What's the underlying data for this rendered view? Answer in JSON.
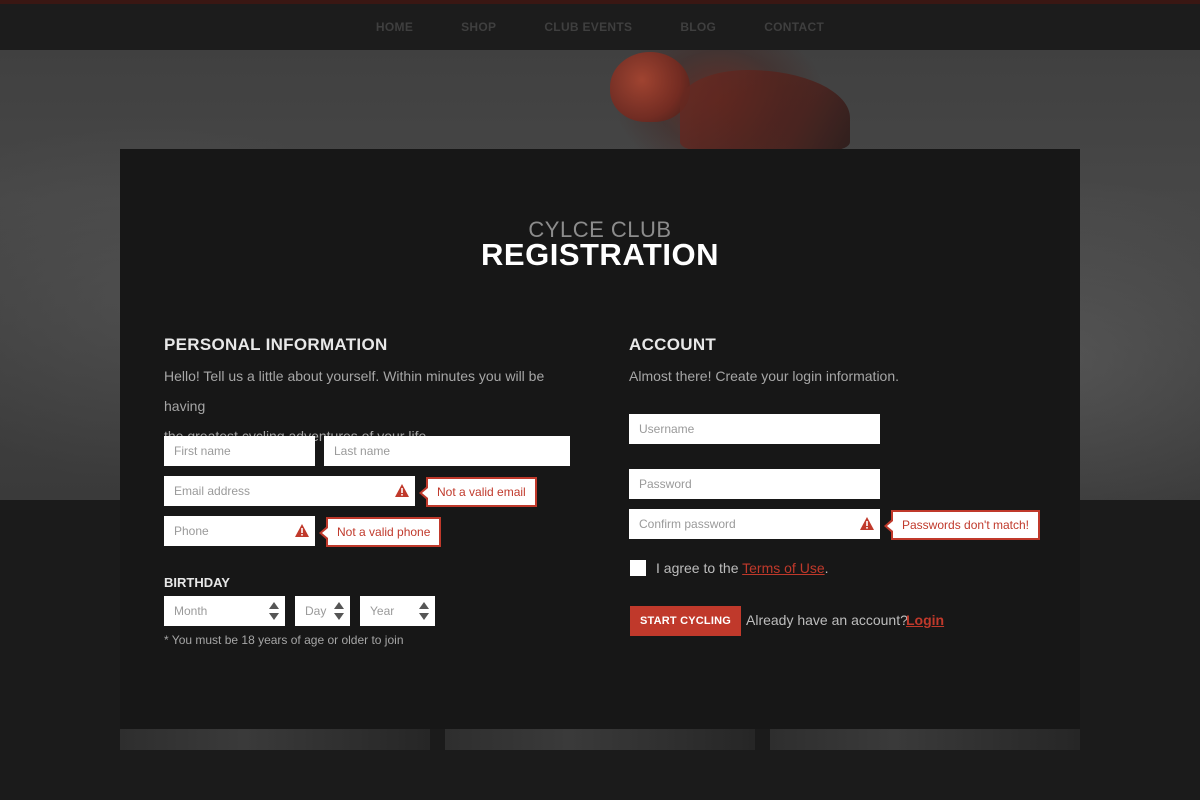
{
  "nav": {
    "items": [
      "HOME",
      "SHOP",
      "CLUB EVENTS",
      "BLOG",
      "CONTACT"
    ]
  },
  "header": {
    "subtitle": "CYLCE CLUB",
    "title": "REGISTRATION"
  },
  "personal": {
    "heading": "PERSONAL INFORMATION",
    "description_line1": "Hello! Tell us a little about yourself. Within minutes you will be having",
    "description_line2": "the greatest cycling adventures of your life.",
    "first_name_placeholder": "First name",
    "last_name_placeholder": "Last name",
    "email_placeholder": "Email address",
    "email_error": "Not a valid email",
    "phone_placeholder": "Phone",
    "phone_error": "Not a valid phone",
    "birthday_label": "BIRTHDAY",
    "month_label": "Month",
    "day_label": "Day",
    "year_label": "Year",
    "age_note": "* You must be 18 years of age or older to join"
  },
  "account": {
    "heading": "ACCOUNT",
    "description": "Almost there! Create your login information.",
    "username_placeholder": "Username",
    "password_placeholder": "Password",
    "confirm_placeholder": "Confirm password",
    "confirm_error": "Passwords don't match!",
    "agree_prefix": "I agree to the ",
    "terms_link": "Terms of Use",
    "agree_suffix": ".",
    "submit_label": "START CYCLING",
    "already_text": "Already have an account?",
    "login_link": "Login"
  },
  "colors": {
    "accent": "#c0392b",
    "card_bg": "#171717",
    "page_bg": "#1b1b1b"
  },
  "icons": {
    "warning": "warning-triangle-icon",
    "select_arrows": "up-down-arrows-icon"
  }
}
